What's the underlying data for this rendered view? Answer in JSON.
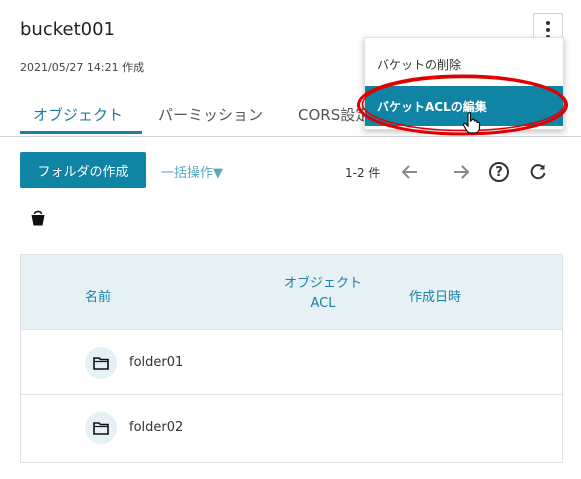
{
  "header": {
    "title": "bucket001",
    "subtitle": "2021/05/27 14:21 作成"
  },
  "tabs": [
    {
      "label": "オブジェクト",
      "active": true
    },
    {
      "label": "パーミッション",
      "active": false
    },
    {
      "label": "CORS設定",
      "active": false
    }
  ],
  "toolbar": {
    "create_folder_label": "フォルダの作成",
    "bulk_label": "一括操作▼",
    "count_label": "1-2 件"
  },
  "table": {
    "headers": [
      "名前",
      "オブジェクトACL",
      "作成日時"
    ],
    "rows": [
      {
        "name": "folder01"
      },
      {
        "name": "folder02"
      }
    ]
  },
  "menu": {
    "items": [
      {
        "label": "バケットの削除",
        "selected": false
      },
      {
        "label": "バケットACLの編集",
        "selected": true
      }
    ]
  },
  "colors": {
    "accent": "#0f84a5",
    "link": "#1b7fa3",
    "header_bg": "#e5f1f5",
    "annotation": "#e00000"
  }
}
